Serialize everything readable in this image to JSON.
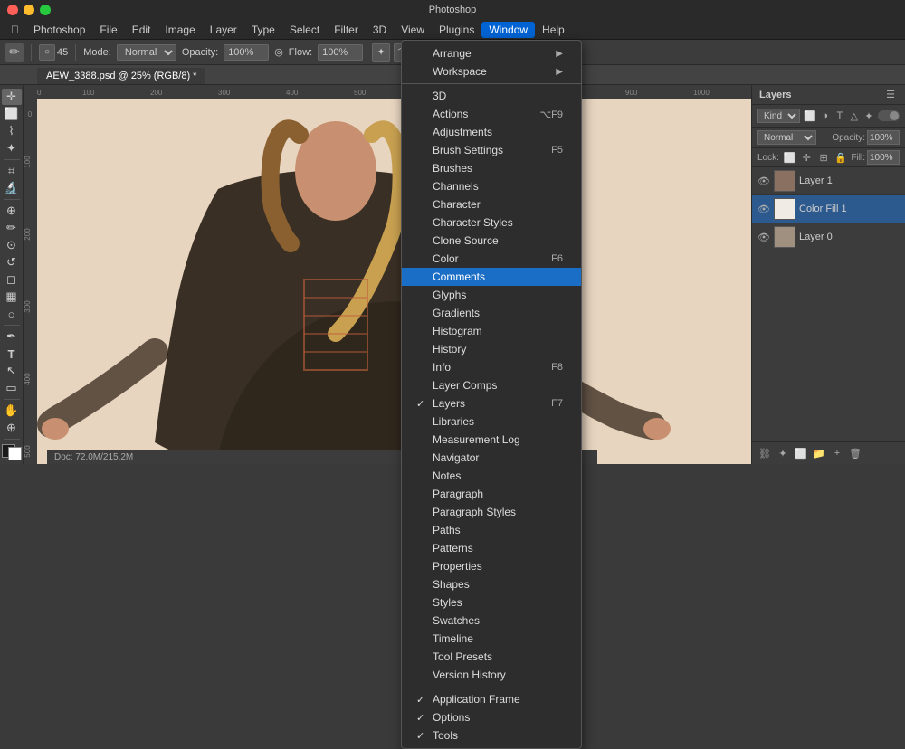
{
  "titlebar": {
    "app_name": "Photoshop"
  },
  "menubar": {
    "items": [
      "Apple",
      "Photoshop",
      "File",
      "Edit",
      "Image",
      "Layer",
      "Type",
      "Select",
      "Filter",
      "3D",
      "View",
      "Plugins",
      "Window",
      "Help"
    ]
  },
  "optionsbar": {
    "mode_label": "Mode:",
    "mode_value": "Normal",
    "opacity_label": "Opacity:",
    "opacity_value": "100%",
    "flow_label": "Flow:",
    "flow_value": "100%",
    "size_value": "45"
  },
  "tab": {
    "label": "AEW_3388.psd @ 25% (RGB/8) *"
  },
  "window_menu": {
    "items": [
      {
        "id": "arrange",
        "label": "Arrange",
        "check": "",
        "shortcut": "",
        "has_arrow": true
      },
      {
        "id": "workspace",
        "label": "Workspace",
        "check": "",
        "shortcut": "",
        "has_arrow": true
      },
      {
        "id": "sep1",
        "type": "separator"
      },
      {
        "id": "3d",
        "label": "3D",
        "check": "",
        "shortcut": ""
      },
      {
        "id": "actions",
        "label": "Actions",
        "check": "",
        "shortcut": "⌥F9"
      },
      {
        "id": "adjustments",
        "label": "Adjustments",
        "check": "",
        "shortcut": ""
      },
      {
        "id": "brush-settings",
        "label": "Brush Settings",
        "check": "",
        "shortcut": "F5"
      },
      {
        "id": "brushes",
        "label": "Brushes",
        "check": "",
        "shortcut": ""
      },
      {
        "id": "channels",
        "label": "Channels",
        "check": "",
        "shortcut": ""
      },
      {
        "id": "character",
        "label": "Character",
        "check": "",
        "shortcut": ""
      },
      {
        "id": "character-styles",
        "label": "Character Styles",
        "check": "",
        "shortcut": ""
      },
      {
        "id": "clone-source",
        "label": "Clone Source",
        "check": "",
        "shortcut": ""
      },
      {
        "id": "color",
        "label": "Color",
        "check": "",
        "shortcut": "F6"
      },
      {
        "id": "comments",
        "label": "Comments",
        "check": "",
        "shortcut": "",
        "highlighted": true
      },
      {
        "id": "glyphs",
        "label": "Glyphs",
        "check": "",
        "shortcut": ""
      },
      {
        "id": "gradients",
        "label": "Gradients",
        "check": "",
        "shortcut": ""
      },
      {
        "id": "histogram",
        "label": "Histogram",
        "check": "",
        "shortcut": ""
      },
      {
        "id": "history",
        "label": "History",
        "check": "",
        "shortcut": ""
      },
      {
        "id": "info",
        "label": "Info",
        "check": "",
        "shortcut": "F8"
      },
      {
        "id": "layer-comps",
        "label": "Layer Comps",
        "check": "",
        "shortcut": ""
      },
      {
        "id": "layers",
        "label": "Layers",
        "check": "✓",
        "shortcut": "F7"
      },
      {
        "id": "libraries",
        "label": "Libraries",
        "check": "",
        "shortcut": ""
      },
      {
        "id": "measurement-log",
        "label": "Measurement Log",
        "check": "",
        "shortcut": ""
      },
      {
        "id": "navigator",
        "label": "Navigator",
        "check": "",
        "shortcut": ""
      },
      {
        "id": "notes",
        "label": "Notes",
        "check": "",
        "shortcut": ""
      },
      {
        "id": "paragraph",
        "label": "Paragraph",
        "check": "",
        "shortcut": ""
      },
      {
        "id": "paragraph-styles",
        "label": "Paragraph Styles",
        "check": "",
        "shortcut": ""
      },
      {
        "id": "paths",
        "label": "Paths",
        "check": "",
        "shortcut": ""
      },
      {
        "id": "patterns",
        "label": "Patterns",
        "check": "",
        "shortcut": ""
      },
      {
        "id": "properties",
        "label": "Properties",
        "check": "",
        "shortcut": ""
      },
      {
        "id": "shapes",
        "label": "Shapes",
        "check": "",
        "shortcut": ""
      },
      {
        "id": "styles",
        "label": "Styles",
        "check": "",
        "shortcut": ""
      },
      {
        "id": "swatches",
        "label": "Swatches",
        "check": "",
        "shortcut": ""
      },
      {
        "id": "timeline",
        "label": "Timeline",
        "check": "",
        "shortcut": ""
      },
      {
        "id": "tool-presets",
        "label": "Tool Presets",
        "check": "",
        "shortcut": ""
      },
      {
        "id": "version-history",
        "label": "Version History",
        "check": "",
        "shortcut": ""
      },
      {
        "id": "sep2",
        "type": "separator"
      },
      {
        "id": "application-frame",
        "label": "Application Frame",
        "check": "✓",
        "shortcut": ""
      },
      {
        "id": "options",
        "label": "Options",
        "check": "✓",
        "shortcut": ""
      },
      {
        "id": "tools",
        "label": "Tools",
        "check": "✓",
        "shortcut": ""
      }
    ]
  },
  "layers_panel": {
    "title": "Layers",
    "filter_label": "Kind",
    "blend_mode": "Normal",
    "opacity_label": "Opacity:",
    "opacity_value": "100%",
    "fill_label": "Fill:",
    "fill_value": "100%",
    "lock_label": "Lock:",
    "layers": [
      {
        "id": "layer1",
        "name": "Layer 1",
        "visible": true,
        "selected": false,
        "thumb_color": "#8a7060"
      },
      {
        "id": "color-fill-1",
        "name": "Color Fill 1",
        "visible": true,
        "selected": true,
        "thumb_color": "#f5f0eb"
      },
      {
        "id": "layer0",
        "name": "Layer 0",
        "visible": true,
        "selected": false,
        "thumb_color": "#a09080"
      }
    ]
  },
  "toolbar": {
    "tools": [
      {
        "id": "move",
        "icon": "✛",
        "label": "move-tool"
      },
      {
        "id": "select-rect",
        "icon": "⬜",
        "label": "rect-select-tool"
      },
      {
        "id": "lasso",
        "icon": "⌇",
        "label": "lasso-tool"
      },
      {
        "id": "magic-wand",
        "icon": "✦",
        "label": "magic-wand-tool"
      },
      {
        "id": "crop",
        "icon": "⌗",
        "label": "crop-tool"
      },
      {
        "id": "eyedropper",
        "icon": "⌛",
        "label": "eyedropper-tool"
      },
      {
        "id": "heal",
        "icon": "✚",
        "label": "heal-tool"
      },
      {
        "id": "brush",
        "icon": "✏",
        "label": "brush-tool"
      },
      {
        "id": "stamp",
        "icon": "⊕",
        "label": "stamp-tool"
      },
      {
        "id": "history-brush",
        "icon": "↺",
        "label": "history-brush-tool"
      },
      {
        "id": "eraser",
        "icon": "◻",
        "label": "eraser-tool"
      },
      {
        "id": "gradient",
        "icon": "▦",
        "label": "gradient-tool"
      },
      {
        "id": "dodge",
        "icon": "◯",
        "label": "dodge-tool"
      },
      {
        "id": "pen",
        "icon": "✒",
        "label": "pen-tool"
      },
      {
        "id": "type",
        "icon": "T",
        "label": "type-tool"
      },
      {
        "id": "path-select",
        "icon": "↖",
        "label": "path-select-tool"
      },
      {
        "id": "shape",
        "icon": "▭",
        "label": "shape-tool"
      },
      {
        "id": "hand",
        "icon": "✋",
        "label": "hand-tool"
      },
      {
        "id": "zoom",
        "icon": "⊕",
        "label": "zoom-tool"
      }
    ]
  },
  "statusbar": {
    "text": "Doc: 72.0M/215.2M"
  }
}
